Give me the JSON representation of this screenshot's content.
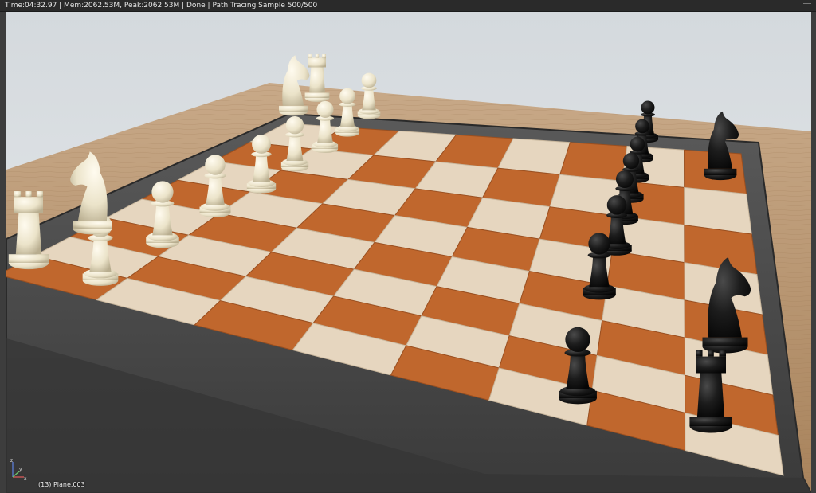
{
  "header": {
    "status_text": "Time:04:32.97 | Mem:2062.53M, Peak:2062.53M | Done | Path Tracing Sample 500/500"
  },
  "viewport": {
    "object_label": "(13) Plane.003",
    "axis_labels": {
      "x": "x",
      "y": "y",
      "z": "z"
    }
  },
  "colors": {
    "header_bg": "#2a2a2a",
    "sky": "#e3e7ea",
    "table_wood": "#b38e6a",
    "frame_stone": "#4a4a4a",
    "light_square": "#e6d6bf",
    "dark_square": "#c0672d",
    "white_piece": "#efe8d1",
    "black_piece": "#1a1a1a"
  },
  "scene": {
    "white_pieces": [
      "rook",
      "knight",
      "pawn",
      "pawn",
      "pawn",
      "pawn",
      "pawn",
      "pawn",
      "pawn",
      "pawn",
      "knight",
      "rook"
    ],
    "black_pieces": [
      "knight",
      "pawn",
      "pawn",
      "pawn",
      "pawn",
      "pawn",
      "pawn",
      "pawn",
      "pawn",
      "knight",
      "rook"
    ]
  }
}
